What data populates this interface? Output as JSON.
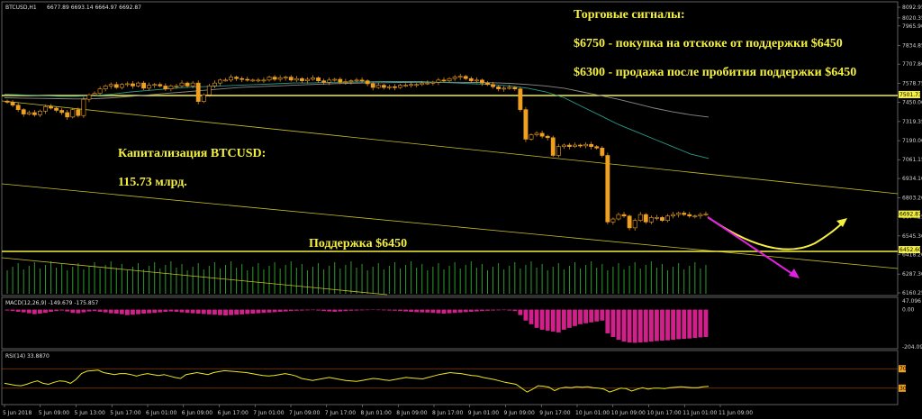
{
  "header": {
    "symbol": "BTCUSD,H1",
    "ohlc": "6677.89 6693.14 6664.97 6692.87"
  },
  "annotations": {
    "signals_title": "Торговые сигналы:",
    "signal_buy": "$6750 -  покупка на отскоке от поддержки $6450",
    "signal_sell": "$6300 - продажа после пробития поддержки $6450",
    "cap_title": "Капитализация BTCUSD:",
    "cap_value": "115.73 млрд.",
    "support_label": "Поддержка $6450"
  },
  "colors": {
    "background": "#000000",
    "bull": "#f0a020",
    "bear": "#f0a020",
    "ma_teal": "#2a9a8a",
    "ma_gray": "#8a8a8a",
    "trendline": "#c8c020",
    "support": "#f4f040",
    "volume": "#2e9a2e",
    "macd": "#d0208a",
    "rsi": "#e8e820",
    "arrow_up": "#f4f040",
    "arrow_down": "#e020e0",
    "price_label_bg": "#f4f040"
  },
  "chart_data": [
    {
      "type": "candlestick",
      "panel": "price",
      "x_labels": [
        "5 Jun 2018",
        "5 Jun 09:00",
        "5 Jun 13:00",
        "5 Jun 17:00",
        "6 Jun 01:00",
        "6 Jun 09:00",
        "6 Jun 17:00",
        "7 Jun 01:00",
        "7 Jun 09:00",
        "7 Jun 17:00",
        "8 Jun 01:00",
        "8 Jun 09:00",
        "8 Jun 17:00",
        "9 Jun 01:00",
        "9 Jun 09:00",
        "9 Jun 17:00",
        "10 Jun 01:00",
        "10 Jun 09:00",
        "10 Jun 17:00",
        "11 Jun 01:00",
        "11 Jun 09:00"
      ],
      "y_ticks": [
        8092.95,
        8020.35,
        7965.9,
        7834.85,
        7707.8,
        7578.75,
        7450.0,
        7319.35,
        7190.0,
        7061.15,
        6934.1,
        6803.2,
        6674.25,
        6545.3,
        6418.2,
        6287.3,
        6160.25
      ],
      "ylim": [
        6160.25,
        8092.95
      ],
      "price_labels": [
        7501.73,
        6692.87,
        6452.6
      ],
      "support_level": 6450,
      "close": [
        7450,
        7430,
        7400,
        7370,
        7380,
        7365,
        7390,
        7420,
        7410,
        7395,
        7380,
        7350,
        7400,
        7360,
        7470,
        7500,
        7510,
        7540,
        7560,
        7570,
        7550,
        7570,
        7575,
        7560,
        7580,
        7545,
        7565,
        7570,
        7560,
        7540,
        7560,
        7560,
        7580,
        7560,
        7580,
        7455,
        7500,
        7560,
        7580,
        7600,
        7600,
        7620,
        7610,
        7605,
        7600,
        7600,
        7600,
        7600,
        7620,
        7605,
        7615,
        7620,
        7600,
        7610,
        7595,
        7605,
        7615,
        7595,
        7585,
        7600,
        7605,
        7585,
        7590,
        7595,
        7600,
        7595,
        7575,
        7550,
        7565,
        7550,
        7555,
        7550,
        7565,
        7565,
        7570,
        7570,
        7580,
        7580,
        7585,
        7600,
        7595,
        7610,
        7620,
        7625,
        7610,
        7595,
        7600,
        7580,
        7570,
        7555,
        7540,
        7545,
        7550,
        7540,
        7400,
        7200,
        7230,
        7240,
        7220,
        7210,
        7090,
        7150,
        7160,
        7150,
        7160,
        7155,
        7165,
        7150,
        7140,
        7090,
        6640,
        6660,
        6690,
        6680,
        6600,
        6650,
        6690,
        6640,
        6670,
        6670,
        6650,
        6680,
        6690,
        6700,
        6690,
        6680,
        6680,
        6690,
        6692.87
      ],
      "ma_teal": [
        7505,
        7500,
        7495,
        7490,
        7490,
        7495,
        7505,
        7520,
        7530,
        7540,
        7550,
        7555,
        7560,
        7565,
        7570,
        7575,
        7580,
        7580,
        7585,
        7585,
        7588,
        7590,
        7590,
        7590,
        7585,
        7580,
        7575,
        7570,
        7560,
        7545,
        7520,
        7480,
        7420,
        7360,
        7300,
        7250,
        7200,
        7150,
        7100,
        7070
      ],
      "ma_gray": [
        7480,
        7478,
        7476,
        7474,
        7472,
        7474,
        7480,
        7490,
        7500,
        7510,
        7520,
        7530,
        7540,
        7550,
        7555,
        7560,
        7565,
        7570,
        7575,
        7578,
        7580,
        7582,
        7584,
        7585,
        7585,
        7585,
        7584,
        7582,
        7578,
        7570,
        7560,
        7545,
        7520,
        7495,
        7470,
        7440,
        7410,
        7385,
        7365,
        7350
      ]
    },
    {
      "type": "bar",
      "panel": "volume",
      "values_relative": "uniform_green_histogram"
    },
    {
      "type": "histogram",
      "panel": "MACD",
      "title": "MACD(12,26,9) -149.679 -175.857",
      "y_ticks": [
        47.096,
        0.0,
        -204.092
      ],
      "ylim": [
        -204.092,
        47.096
      ],
      "values": [
        -5,
        -8,
        -12,
        -15,
        -20,
        -25,
        -22,
        -18,
        -12,
        -8,
        -5,
        -10,
        -18,
        -20,
        -15,
        -10,
        -8,
        -12,
        -15,
        -20,
        -22,
        -25,
        -30,
        -28,
        -25,
        -22,
        -20,
        -18,
        -15,
        -12,
        -10,
        -12,
        -15,
        -18,
        -20,
        -22,
        -24,
        -26,
        -28,
        -30,
        -32,
        -30,
        -28,
        -26,
        -24,
        -22,
        -20,
        -18,
        -16,
        -14,
        -12,
        -10,
        -8,
        -6,
        -5,
        -4,
        -3,
        -5,
        -8,
        -10,
        -12,
        -10,
        -8,
        -6,
        -5,
        -4,
        -3,
        -2,
        -3,
        -4,
        -5,
        -6,
        -8,
        -10,
        -12,
        -14,
        -15,
        -16,
        -18,
        -20,
        -22,
        -20,
        -18,
        -16,
        -14,
        -12,
        -10,
        -8,
        -6,
        -5,
        -4,
        -3,
        -5,
        -8,
        -30,
        -60,
        -80,
        -100,
        -110,
        -115,
        -120,
        -125,
        -110,
        -100,
        -90,
        -80,
        -75,
        -70,
        -65,
        -60,
        -130,
        -150,
        -165,
        -175,
        -180,
        -182,
        -180,
        -178,
        -175,
        -172,
        -170,
        -168,
        -165,
        -162,
        -160,
        -158,
        -155,
        -152,
        -150
      ]
    },
    {
      "type": "line",
      "panel": "RSI",
      "title": "RSI(14) 33.8870",
      "y_ticks": [
        70,
        30
      ],
      "ylim": [
        0,
        100
      ],
      "values": [
        40,
        38,
        36,
        35,
        38,
        42,
        45,
        40,
        38,
        42,
        45,
        44,
        40,
        48,
        60,
        65,
        66,
        67,
        62,
        60,
        58,
        60,
        60,
        58,
        55,
        58,
        60,
        58,
        56,
        58,
        55,
        52,
        50,
        58,
        60,
        62,
        60,
        58,
        62,
        64,
        66,
        65,
        64,
        63,
        62,
        60,
        58,
        56,
        55,
        56,
        58,
        60,
        58,
        55,
        50,
        48,
        46,
        48,
        50,
        52,
        50,
        48,
        46,
        45,
        44,
        46,
        48,
        50,
        49,
        47,
        46,
        48,
        50,
        52,
        51,
        50,
        49,
        52,
        55,
        58,
        60,
        62,
        61,
        60,
        58,
        56,
        55,
        52,
        50,
        48,
        45,
        42,
        40,
        38,
        30,
        22,
        28,
        35,
        34,
        32,
        25,
        30,
        32,
        31,
        33,
        32,
        33,
        31,
        30,
        28,
        22,
        26,
        30,
        29,
        24,
        28,
        31,
        28,
        30,
        30,
        29,
        31,
        32,
        33,
        32,
        31,
        31,
        33,
        33.887
      ]
    }
  ]
}
